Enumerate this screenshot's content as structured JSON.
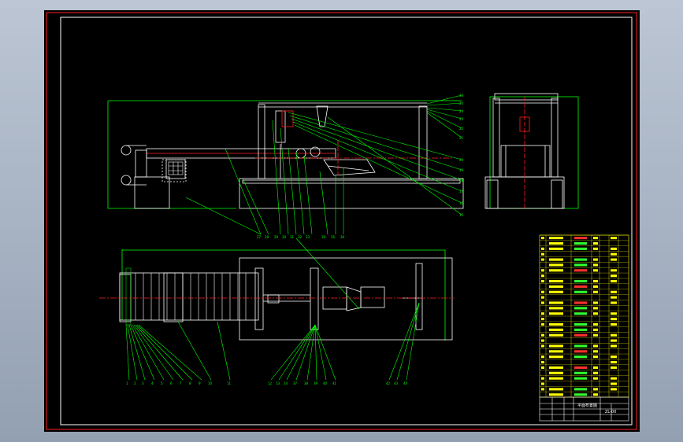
{
  "colors": {
    "background": "#000000",
    "frame": "#ff2020",
    "leader": "#00ff00",
    "geometry": "#ffffff",
    "centerline": "#ff2020",
    "title_block": "#ffff00",
    "bom_red": "#ff3030",
    "bom_green": "#30ff30"
  },
  "icons": [
    "cad-frame-border",
    "title-block",
    "bill-of-materials"
  ],
  "title_block": {
    "drawing_title": "平面布置图",
    "code": "ZL-00"
  },
  "bom": {
    "row_count": 30
  }
}
